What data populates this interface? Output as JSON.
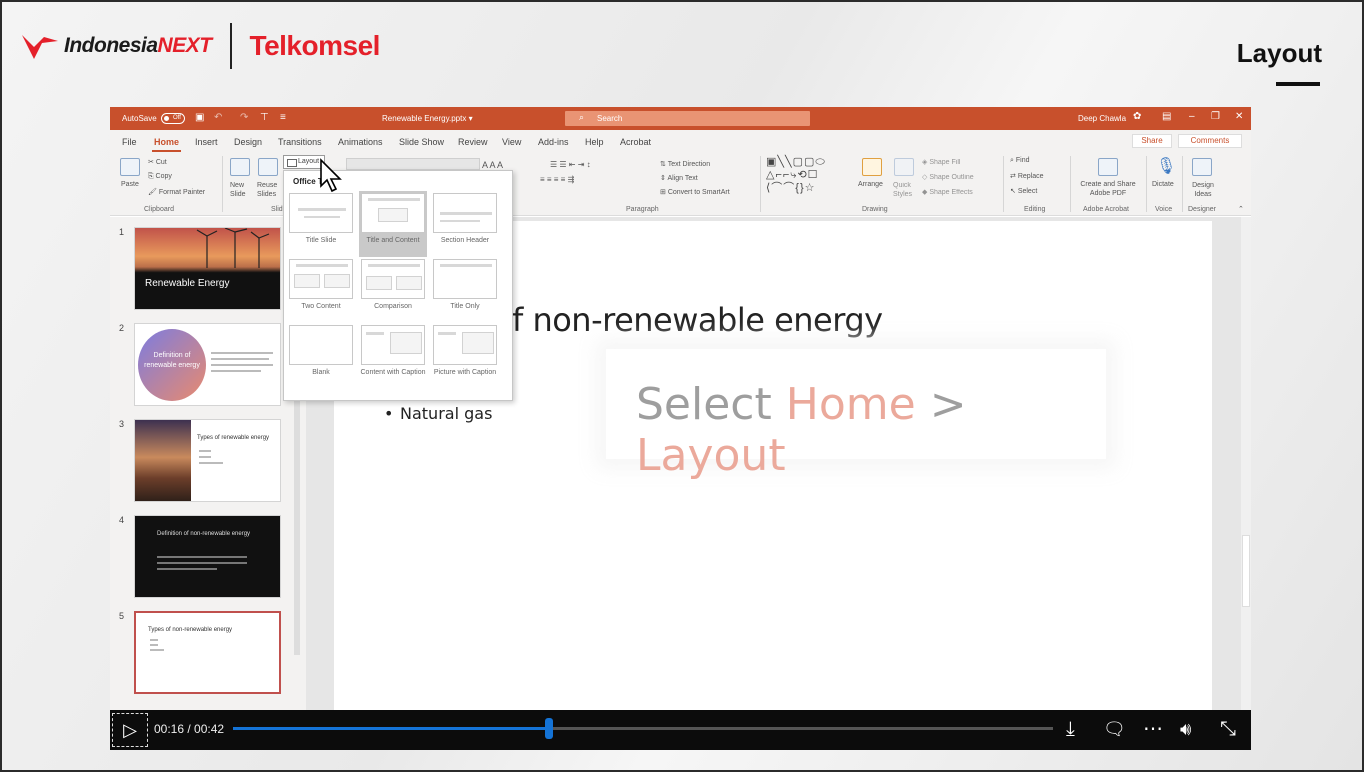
{
  "brand": {
    "indonesia": "Indonesia",
    "next": "NEXT",
    "telkomsel": "Telkomsel",
    "brand_color": "#e4202a"
  },
  "page_title": "Layout",
  "ppt": {
    "autosave": "AutoSave",
    "autosave_state": "Off",
    "doc_name": "Renewable Energy.pptx ▾",
    "search_placeholder": "Search",
    "user": "Deep Chawla",
    "accent_color": "#c8502c",
    "tabs": [
      "File",
      "Home",
      "Insert",
      "Design",
      "Transitions",
      "Animations",
      "Slide Show",
      "Review",
      "View",
      "Add-ins",
      "Help",
      "Acrobat"
    ],
    "share": "Share",
    "comments": "Comments",
    "ribbon": {
      "paste": "Paste",
      "cut": "Cut",
      "copy": "Copy",
      "format_painter": "Format Painter",
      "clipboard": "Clipboard",
      "new_slide": "New Slide",
      "reuse_slides": "Reuse Slides",
      "slides_group": "Slid",
      "layout": "Layout",
      "text_direction": "Text Direction",
      "align_text": "Align Text",
      "convert_smartart": "Convert to SmartArt",
      "paragraph": "Paragraph",
      "arrange": "Arrange",
      "quick_styles": "Quick Styles",
      "shape_fill": "Shape Fill",
      "shape_outline": "Shape Outline",
      "shape_effects": "Shape Effects",
      "drawing": "Drawing",
      "find": "Find",
      "replace": "Replace",
      "select": "Select",
      "editing": "Editing",
      "create_share_pdf": "Create and Share Adobe PDF",
      "adobe_acrobat": "Adobe Acrobat",
      "dictate": "Dictate",
      "voice": "Voice",
      "design_ideas": "Design Ideas",
      "designer": "Designer"
    },
    "layout_menu": {
      "header": "Office T",
      "items": [
        "Title Slide",
        "Title and Content",
        "Section Header",
        "Two Content",
        "Comparison",
        "Title Only",
        "Blank",
        "Content with Caption",
        "Picture with Caption"
      ],
      "selected": "Title and Content"
    },
    "thumbnails": [
      {
        "num": "1",
        "title": "Renewable Energy"
      },
      {
        "num": "2",
        "title": "Definition of renewable energy"
      },
      {
        "num": "3",
        "title": "Types of renewable energy"
      },
      {
        "num": "4",
        "title": "Definition of non-renewable energy"
      },
      {
        "num": "5",
        "title": "Types of non-renewable energy"
      }
    ],
    "slide": {
      "title": "f non-renewable energy",
      "bullet": "Natural gas"
    },
    "hint": {
      "select": "Select",
      "home": "Home",
      "sep": ">",
      "layout": "Layout"
    }
  },
  "video": {
    "time": "00:16 / 00:42",
    "progress": 0.385,
    "progress_color": "#1473d6"
  }
}
